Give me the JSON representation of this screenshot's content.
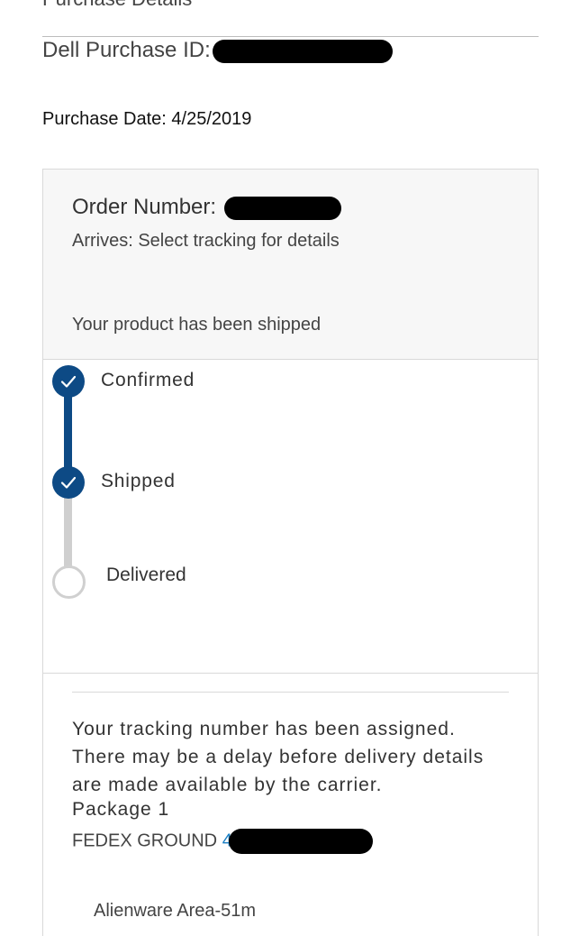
{
  "header": {
    "cut_heading": "Purchase Details",
    "purchase_id_label": "Dell Purchase ID:",
    "purchase_date": "Purchase Date: 4/25/2019"
  },
  "order": {
    "number_label": "Order Number:",
    "arrives": "Arrives: Select tracking for details",
    "status_message": "Your product has been shipped"
  },
  "timeline": {
    "steps": [
      {
        "label": "Confirmed",
        "state": "complete"
      },
      {
        "label": "Shipped",
        "state": "complete"
      },
      {
        "label": "Delivered",
        "state": "pending"
      }
    ]
  },
  "tracking": {
    "message": "Your tracking number has been assigned. There may be a delay before delivery details are made available by the carrier.",
    "package_label": "Package 1",
    "carrier": "FEDEX GROUND",
    "tracking_visible_prefix": "4"
  },
  "product": {
    "name": "Alienware Area-51m"
  },
  "colors": {
    "accent": "#0d4a85",
    "link": "#1a7fc4",
    "redaction": "#000000"
  }
}
